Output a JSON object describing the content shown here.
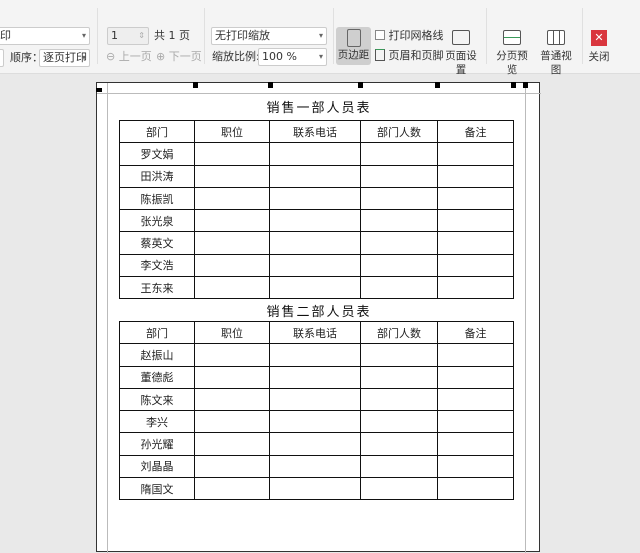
{
  "toolbar": {
    "print_dropdown": "印",
    "order_label": "顺序：",
    "order_value": "逐页打印",
    "page_number": "1",
    "total_pages": "共 1 页",
    "prev_page": "上一页",
    "next_page": "下一页",
    "scale_mode": "无打印缩放",
    "zoom_label": "缩放比例:",
    "zoom_value": "100 %",
    "margins": "页边距",
    "print_gridlines": "打印网格线",
    "header_footer": "页眉和页脚",
    "page_setup": "页面设置",
    "page_break_preview": "分页预览",
    "normal_view": "普通视图",
    "close": "关闭"
  },
  "tables": [
    {
      "title": "销售一部人员表",
      "headers": [
        "部门",
        "职位",
        "联系电话",
        "部门人数",
        "备注"
      ],
      "names": [
        "罗文娟",
        "田洪涛",
        "陈振凯",
        "张光泉",
        "蔡英文",
        "李文浩",
        "王东来"
      ]
    },
    {
      "title": "销售二部人员表",
      "headers": [
        "部门",
        "职位",
        "联系电话",
        "部门人数",
        "备注"
      ],
      "names": [
        "赵振山",
        "董德彪",
        "陈文来",
        "李兴",
        "孙光耀",
        "刘晶晶",
        "隋国文"
      ]
    }
  ],
  "colors": {
    "close_red": "#d9363e",
    "active_bg": "#cfcfcf"
  }
}
